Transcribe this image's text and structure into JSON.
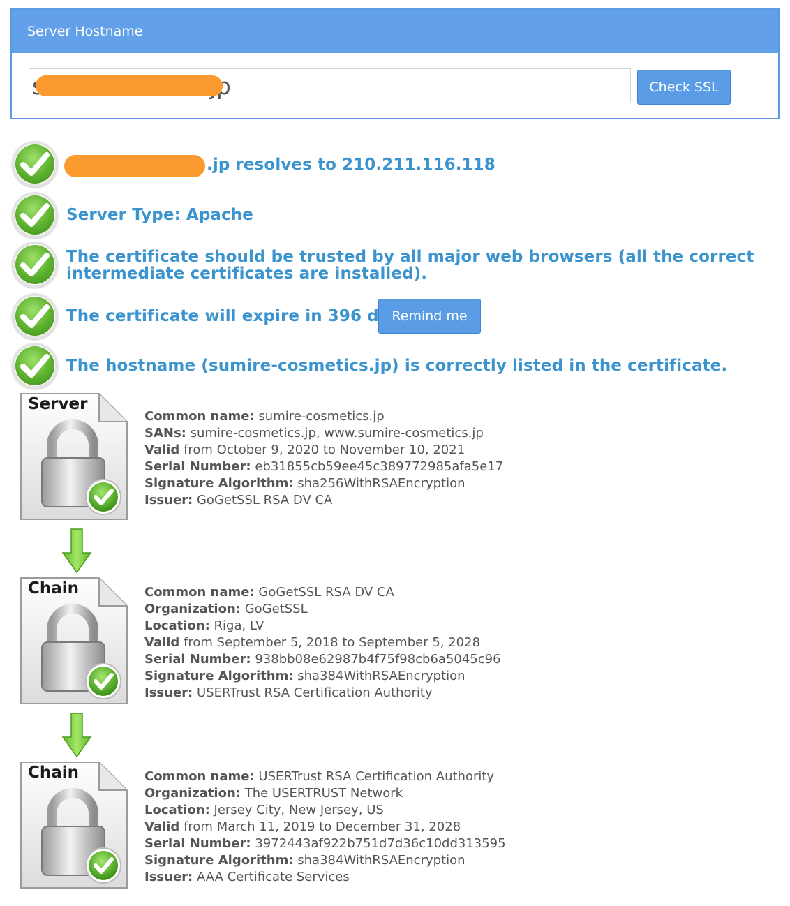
{
  "panel": {
    "title": "Server Hostname",
    "hostname_value": "s                    s.jp",
    "check_button": "Check SSL"
  },
  "results": [
    {
      "text": ".jp resolves to 210.211.116.118"
    },
    {
      "text": "Server Type: Apache"
    },
    {
      "text": "The certificate should be trusted by all major web browsers (all the correct intermediate certificates are installed)."
    },
    {
      "text": "The certificate will expire in 396 days."
    },
    {
      "text": "The hostname (sumire-cosmetics.jp) is correctly listed in the certificate."
    }
  ],
  "remind_button": "Remind me",
  "certs": [
    {
      "label": "Server",
      "common_name_key": "Common name:",
      "common_name": "sumire-cosmetics.jp",
      "sans_key": "SANs:",
      "sans": "sumire-cosmetics.jp, www.sumire-cosmetics.jp",
      "valid_key": "Valid",
      "valid": "from October 9, 2020 to November 10, 2021",
      "serial_key": "Serial Number:",
      "serial": "eb31855cb59ee45c389772985afa5e17",
      "sigalg_key": "Signature Algorithm:",
      "sigalg": "sha256WithRSAEncryption",
      "issuer_key": "Issuer:",
      "issuer": "GoGetSSL RSA DV CA"
    },
    {
      "label": "Chain",
      "common_name_key": "Common name:",
      "common_name": "GoGetSSL RSA DV CA",
      "org_key": "Organization:",
      "org": "GoGetSSL",
      "location_key": "Location:",
      "location": "Riga, LV",
      "valid_key": "Valid",
      "valid": "from September 5, 2018 to September 5, 2028",
      "serial_key": "Serial Number:",
      "serial": "938bb08e62987b4f75f98cb6a5045c96",
      "sigalg_key": "Signature Algorithm:",
      "sigalg": "sha384WithRSAEncryption",
      "issuer_key": "Issuer:",
      "issuer": "USERTrust RSA Certification Authority"
    },
    {
      "label": "Chain",
      "common_name_key": "Common name:",
      "common_name": "USERTrust RSA Certification Authority",
      "org_key": "Organization:",
      "org": "The USERTRUST Network",
      "location_key": "Location:",
      "location": "Jersey City, New Jersey, US",
      "valid_key": "Valid",
      "valid": "from March 11, 2019 to December 31, 2028",
      "serial_key": "Serial Number:",
      "serial": "3972443af922b751d7d36c10dd313595",
      "sigalg_key": "Signature Algorithm:",
      "sigalg": "sha384WithRSAEncryption",
      "issuer_key": "Issuer:",
      "issuer": "AAA Certificate Services"
    }
  ],
  "icons": {
    "status": "green-checkmark-icon",
    "certificate": "padlock-certificate-icon",
    "chain_arrow": "down-arrow-icon"
  },
  "colors": {
    "panel_header": "#62a0ea",
    "button": "#5a9de6",
    "result_text": "#3c94cf",
    "check_green": "#5cb02e",
    "arrow_green": "#7ed23a",
    "redaction": "#fb9a2e"
  }
}
